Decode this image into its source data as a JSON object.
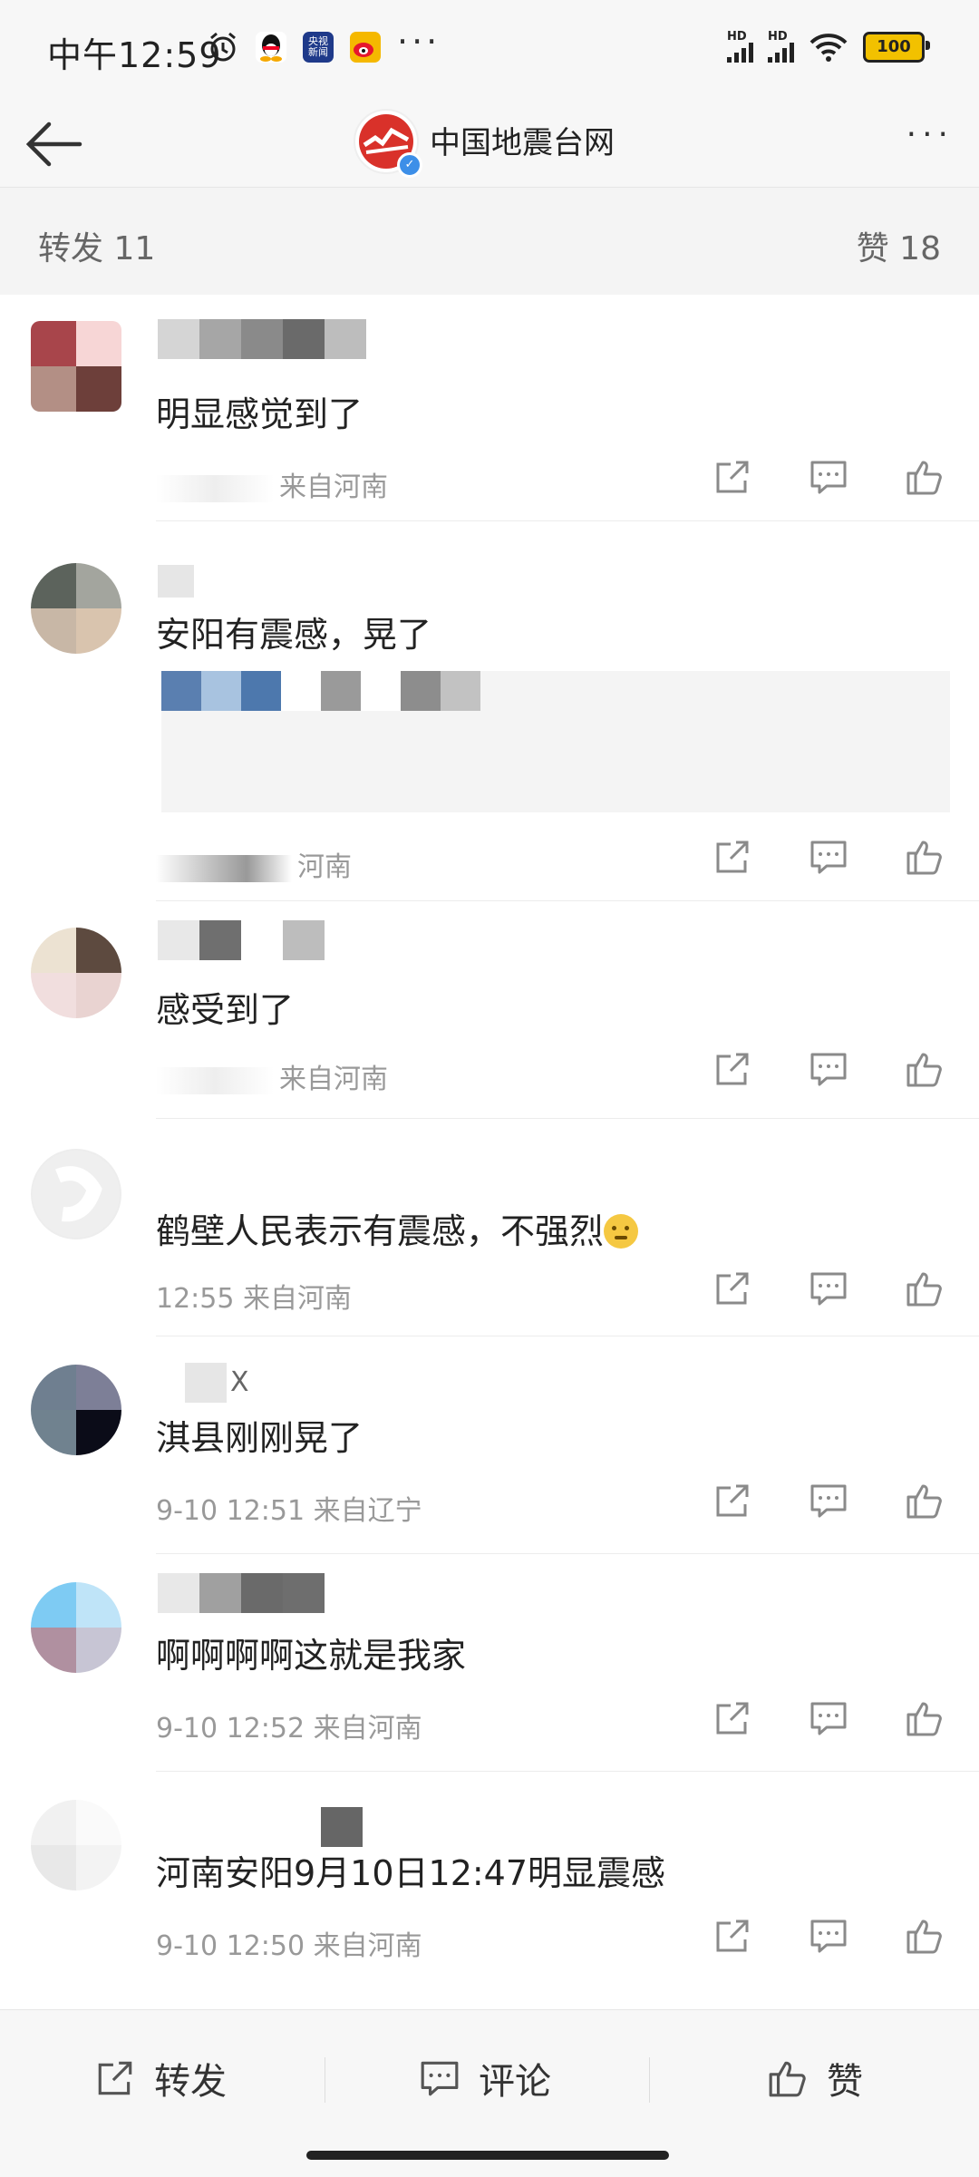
{
  "status_bar": {
    "time": "中午12:59",
    "battery": "100",
    "signal_label": "HD",
    "more_dots": "···"
  },
  "header": {
    "title": "中国地震台网",
    "more": "···"
  },
  "counts": {
    "reposts": "转发 11",
    "likes": "赞 18"
  },
  "comments": [
    {
      "name_visible": "",
      "text": "明显感觉到了",
      "meta": "来自河南"
    },
    {
      "name_visible": "",
      "text": "安阳有震感，晃了",
      "meta": "河南"
    },
    {
      "name_visible": "",
      "text": "感受到了",
      "meta": "来自河南"
    },
    {
      "name_visible": "",
      "text": "鹤壁人民表示有震感，不强烈",
      "meta": "12:55 来自河南"
    },
    {
      "name_visible": "X",
      "text": "淇县刚刚晃了",
      "meta": "9-10 12:51 来自辽宁"
    },
    {
      "name_visible": "",
      "text": "啊啊啊啊这就是我家",
      "meta": "9-10 12:52 来自河南"
    },
    {
      "name_visible": "",
      "text": "河南安阳9月10日12:47明显震感",
      "meta": "9-10 12:50 来自河南"
    }
  ],
  "bottom_bar": {
    "repost": "转发",
    "comment": "评论",
    "like": "赞"
  },
  "colors": {
    "icon_gray": "#8a8a8a",
    "meta_gray": "#999999",
    "verified_blue": "#3d8fe8",
    "logo_red": "#d9312a"
  }
}
